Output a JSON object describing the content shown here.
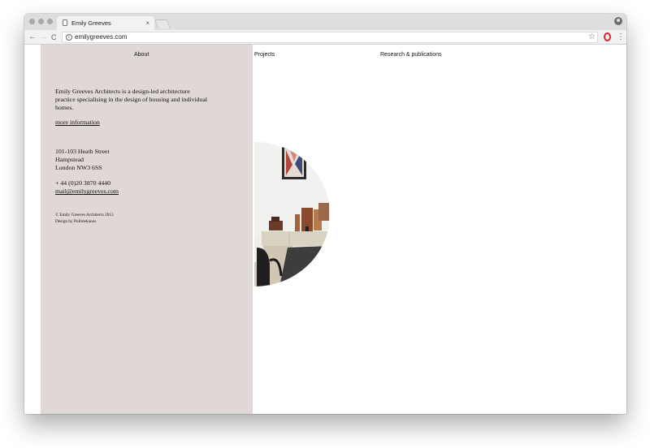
{
  "browser": {
    "tab_title": "Emily Greeves",
    "tab_close": "×",
    "url": "emilygreeves.com",
    "info_icon": "i",
    "back_icon": "←",
    "forward_icon": "→",
    "reload_icon": "C",
    "star_icon": "☆",
    "menu_icon": "⋮"
  },
  "nav": {
    "about": "About",
    "projects": "Projects",
    "research": "Research & publications"
  },
  "sidebar": {
    "intro": "Emily Greeves Architects is a design-led architecture practice specialising in the design of housing and individual homes.",
    "more_link": "more information",
    "address": [
      "101-103 Heath Street",
      "Hampstead",
      "London NW3 6SS"
    ],
    "phone": "+ 44 (0)20 3870 4440",
    "email": "mail@emilygreeves.com",
    "copyright": "© Emily Greeves Architects 2013",
    "credit": "Design by Polimekanos"
  },
  "colors": {
    "sidebar_bg": "#e0d8d7",
    "opera_red": "#e0262d"
  }
}
